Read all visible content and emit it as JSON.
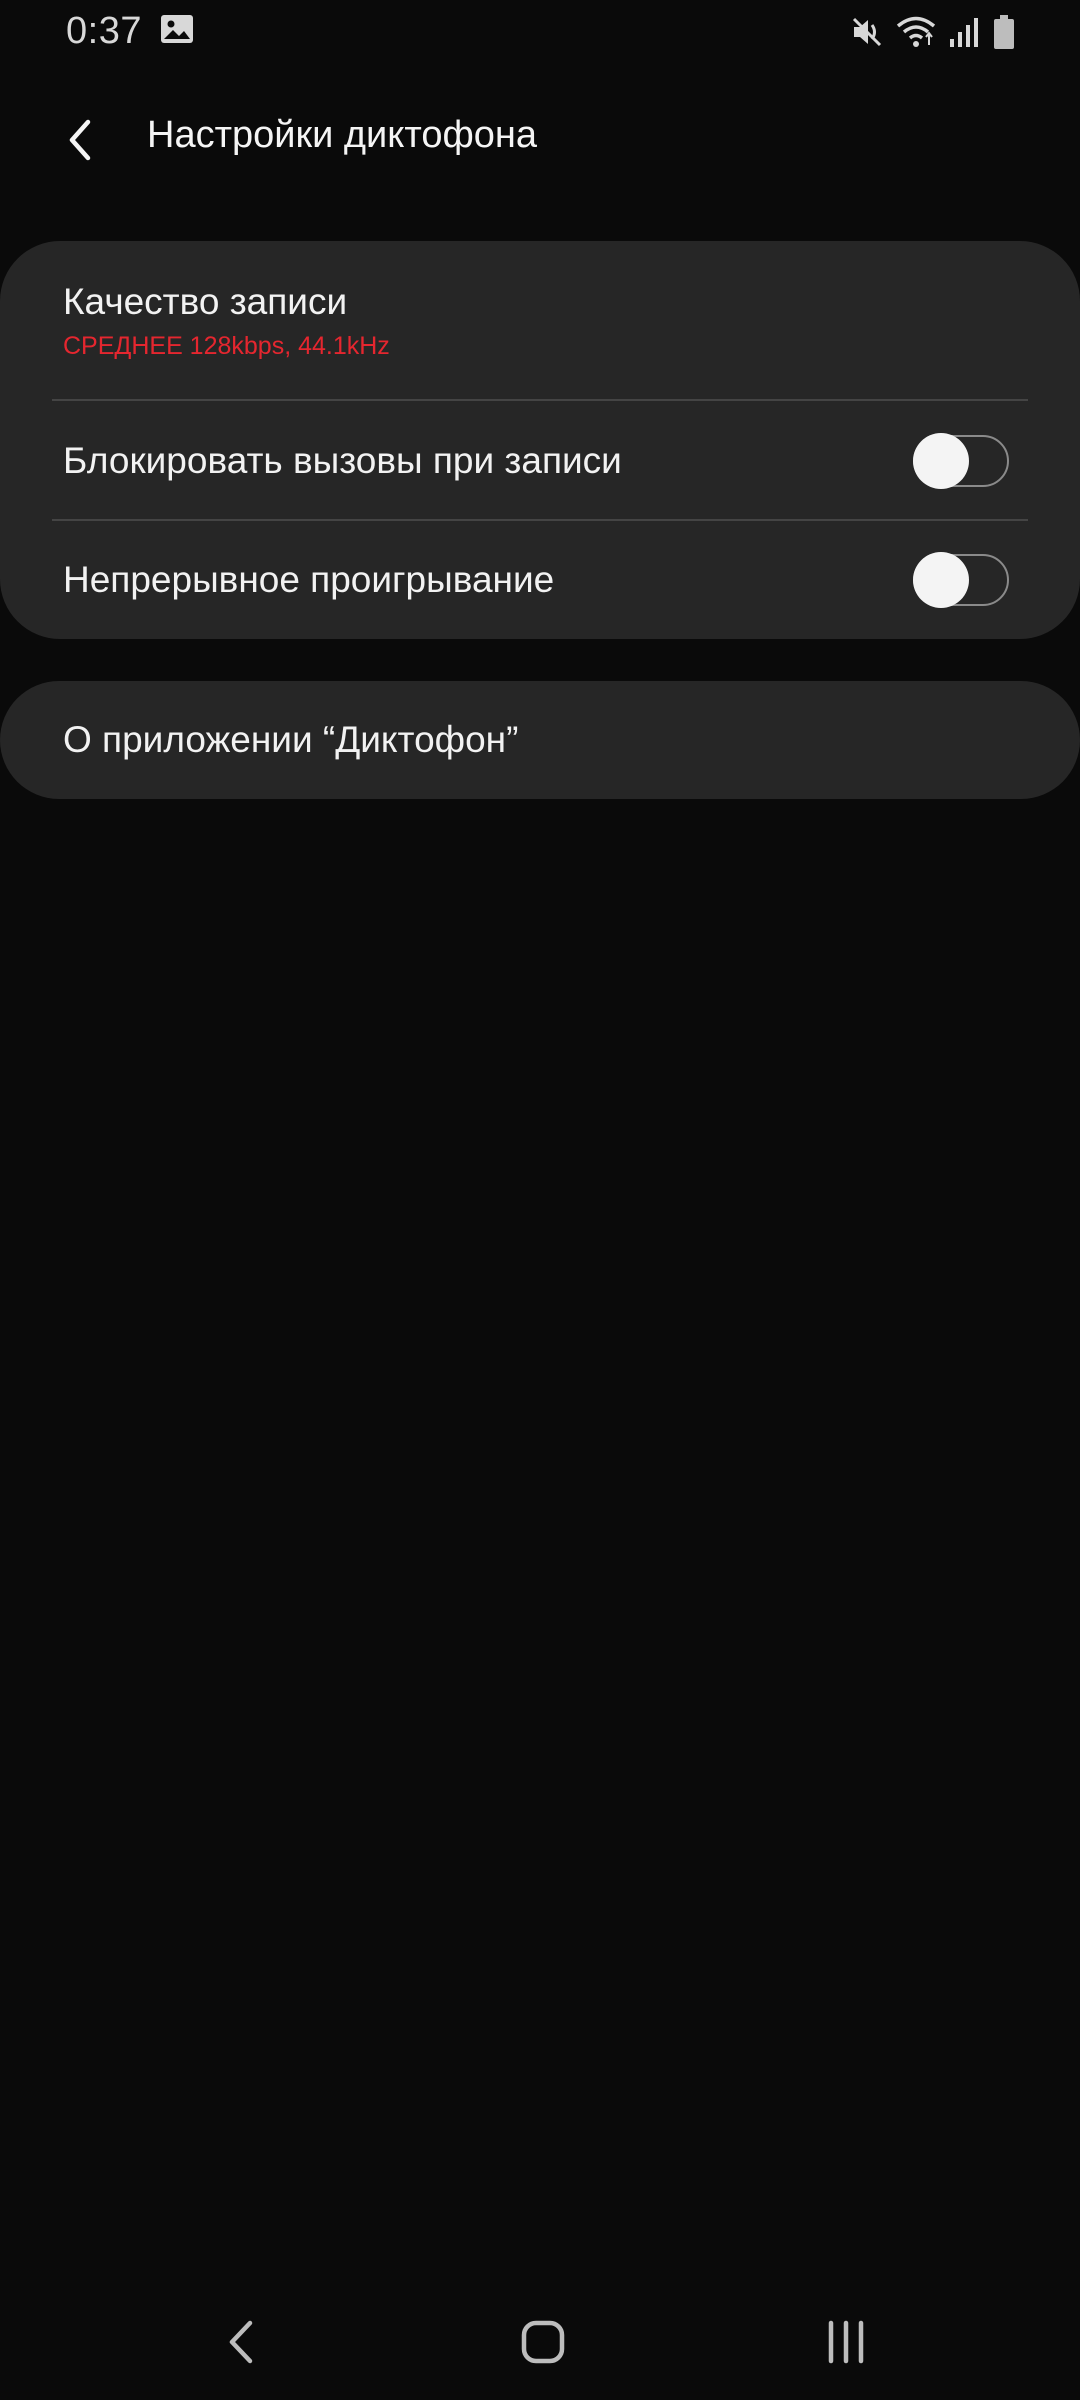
{
  "status_bar": {
    "time": "0:37",
    "icons": [
      "gallery-icon",
      "mute-icon",
      "wifi-icon",
      "signal-icon",
      "battery-icon"
    ]
  },
  "header": {
    "title": "Настройки диктофона",
    "back_icon": "chevron-left-icon"
  },
  "settings": {
    "quality": {
      "title": "Качество записи",
      "value": "СРЕДНЕЕ 128kbps, 44.1kHz"
    },
    "block_calls": {
      "title": "Блокировать вызовы при записи",
      "enabled": false
    },
    "continuous_play": {
      "title": "Непрерывное проигрывание",
      "enabled": false
    }
  },
  "about": {
    "title": "О приложении “Диктофон”"
  },
  "nav_bar": {
    "icons": [
      "back-icon",
      "home-icon",
      "recents-icon"
    ]
  },
  "colors": {
    "background": "#0a0a0a",
    "card": "#262626",
    "accent": "#e5262f",
    "text": "#f2f2f2",
    "divider": "#444444"
  }
}
